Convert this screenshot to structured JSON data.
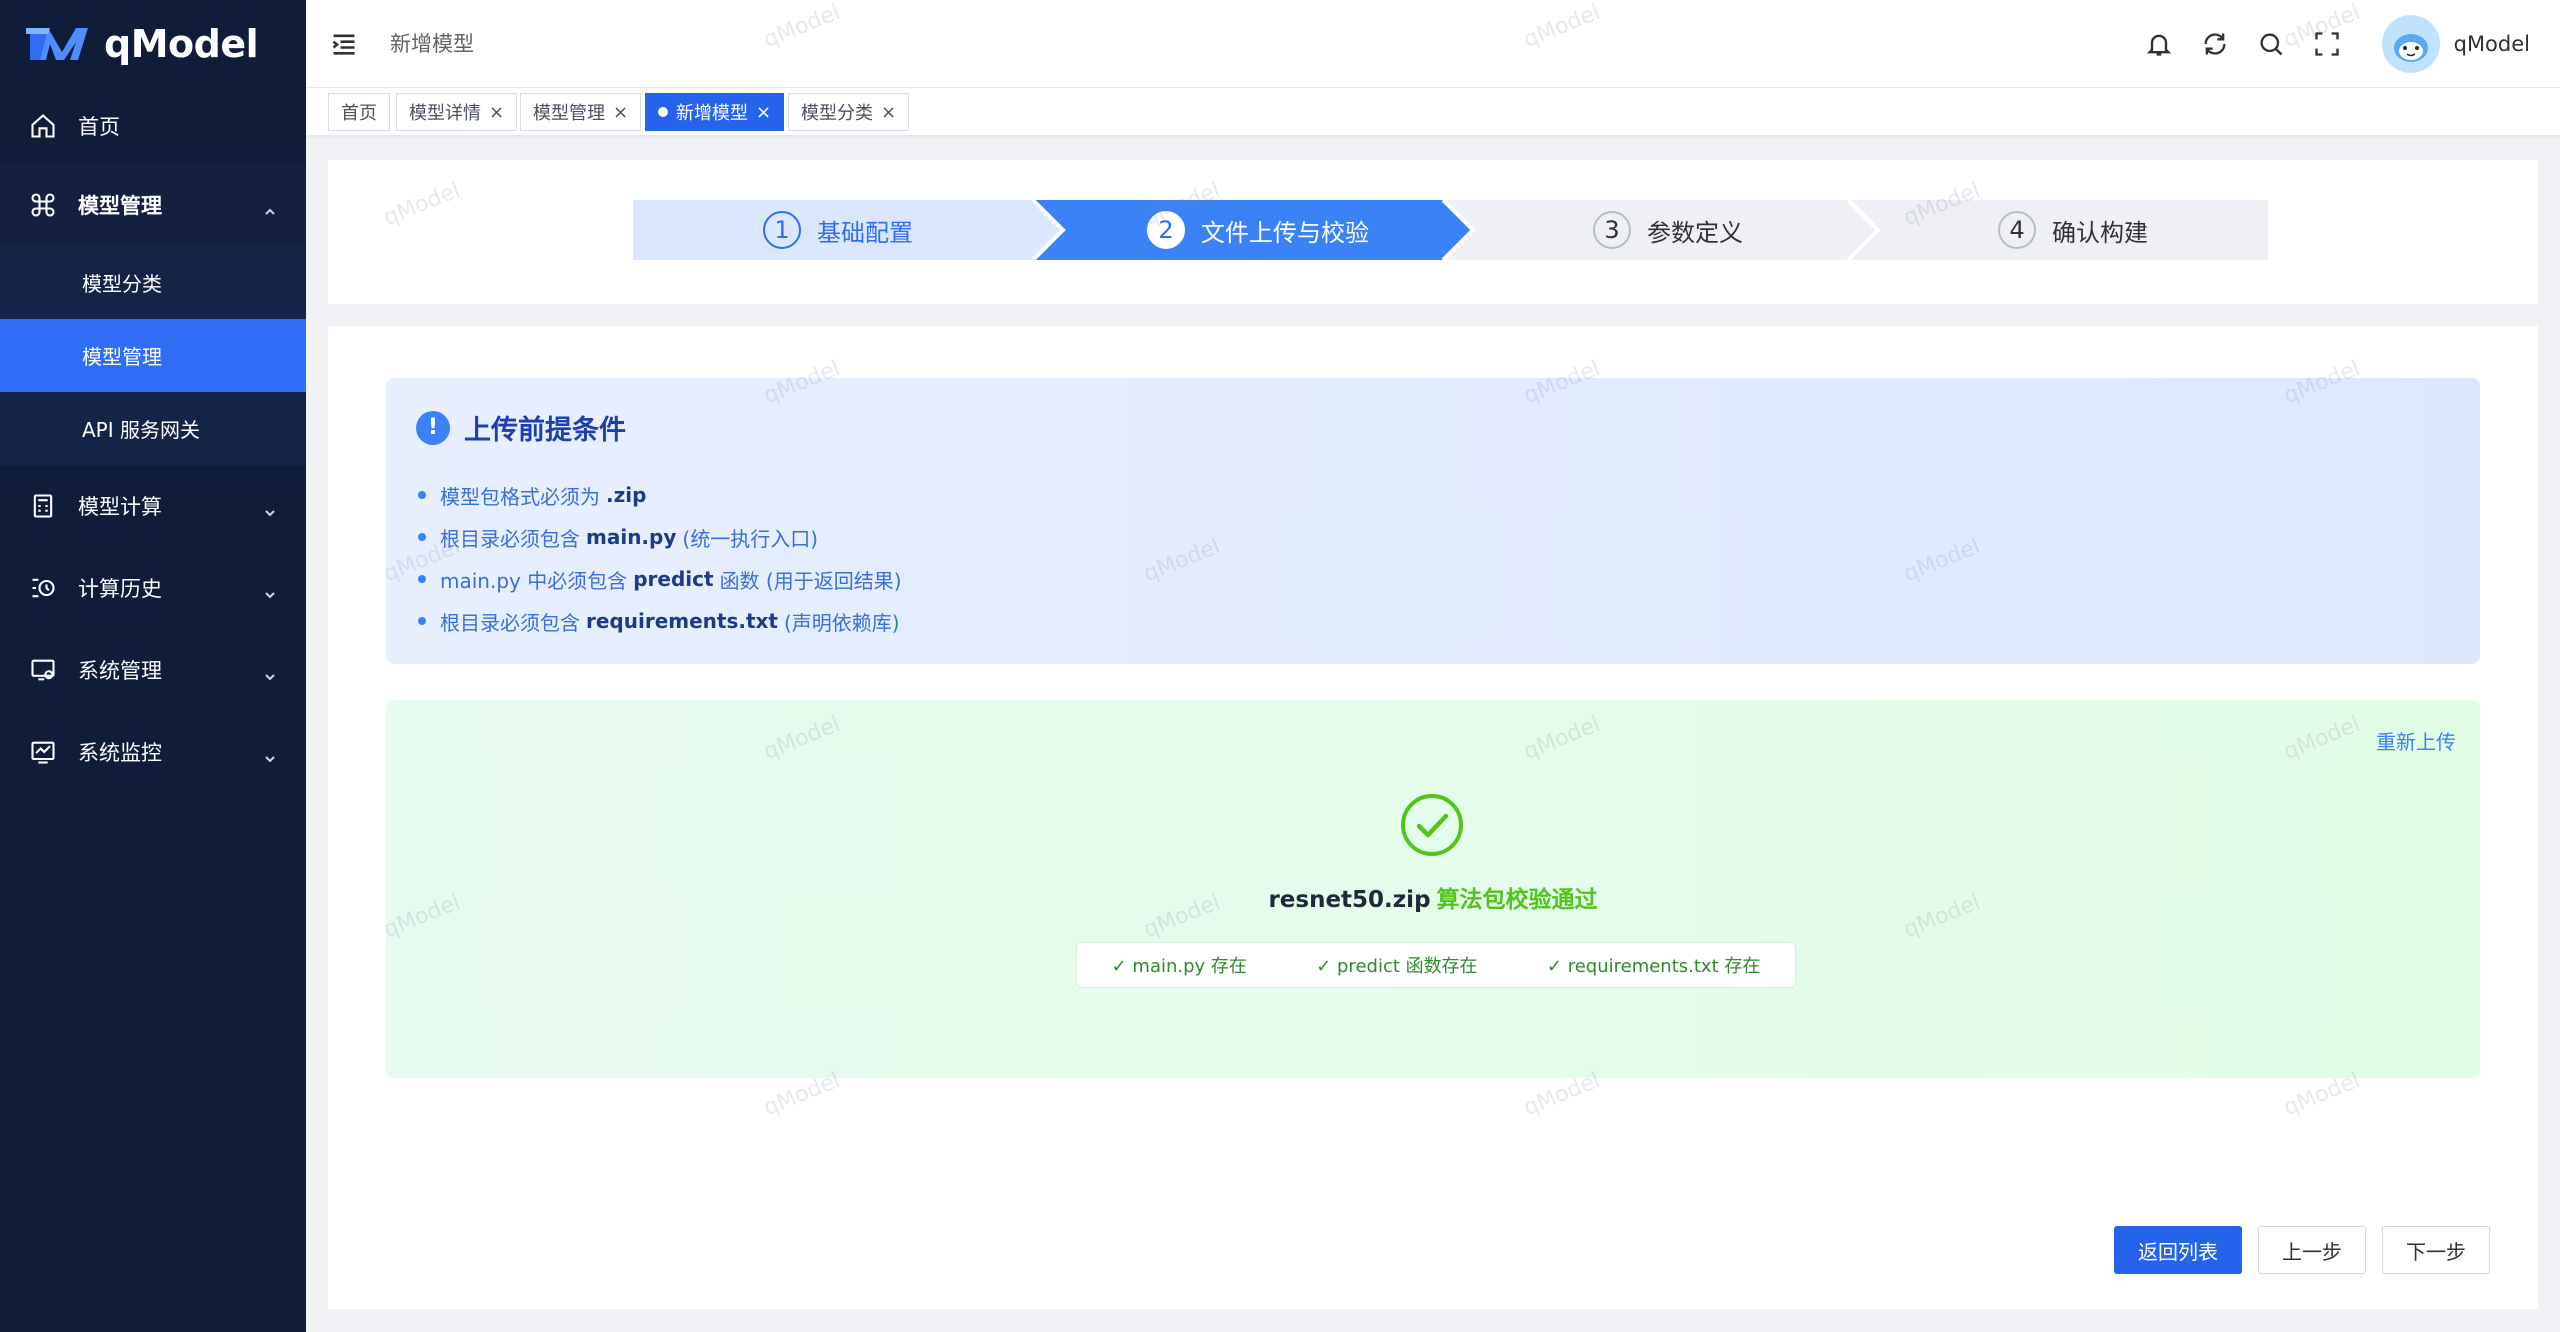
{
  "app": {
    "logo_text": "qModel",
    "watermark": "qModel"
  },
  "sidebar": {
    "items": [
      {
        "label": "首页",
        "icon": "home-icon"
      },
      {
        "label": "模型管理",
        "icon": "command-icon",
        "expanded": true,
        "children": [
          {
            "label": "模型分类",
            "active": false
          },
          {
            "label": "模型管理",
            "active": true
          },
          {
            "label": "API 服务网关",
            "active": false
          }
        ]
      },
      {
        "label": "模型计算",
        "icon": "calculator-icon"
      },
      {
        "label": "计算历史",
        "icon": "history-icon"
      },
      {
        "label": "系统管理",
        "icon": "settings-monitor-icon"
      },
      {
        "label": "系统监控",
        "icon": "monitor-chart-icon"
      }
    ]
  },
  "header": {
    "breadcrumb": "新增模型",
    "username": "qModel"
  },
  "tags": [
    {
      "label": "首页",
      "closable": false,
      "active": false
    },
    {
      "label": "模型详情",
      "closable": true,
      "active": false
    },
    {
      "label": "模型管理",
      "closable": true,
      "active": false
    },
    {
      "label": "新增模型",
      "closable": true,
      "active": true
    },
    {
      "label": "模型分类",
      "closable": true,
      "active": false
    }
  ],
  "steps": [
    {
      "num": "1",
      "label": "基础配置",
      "state": "done"
    },
    {
      "num": "2",
      "label": "文件上传与校验",
      "state": "active"
    },
    {
      "num": "3",
      "label": "参数定义",
      "state": "pending"
    },
    {
      "num": "4",
      "label": "确认构建",
      "state": "pending"
    }
  ],
  "tips": {
    "title": "上传前提条件",
    "items": [
      {
        "pre": "模型包格式必须为",
        "bold": ".zip",
        "post": ""
      },
      {
        "pre": "根目录必须包含",
        "bold": "main.py",
        "post": "(统一执行入口)"
      },
      {
        "pre": "main.py 中必须包含",
        "bold": "predict",
        "post": "函数 (用于返回结果)"
      },
      {
        "pre": "根目录必须包含",
        "bold": "requirements.txt",
        "post": "(声明依赖库)"
      }
    ]
  },
  "upload": {
    "reupload_label": "重新上传",
    "filename": "resnet50.zip",
    "status_text": "算法包校验通过",
    "checks": [
      "✓ main.py 存在",
      "✓ predict 函数存在",
      "✓ requirements.txt 存在"
    ]
  },
  "actions": {
    "back_label": "返回列表",
    "prev_label": "上一步",
    "next_label": "下一步"
  },
  "colors": {
    "primary": "#2563eb",
    "sidebar_bg": "#0f1d3a",
    "success": "#52c41a"
  }
}
